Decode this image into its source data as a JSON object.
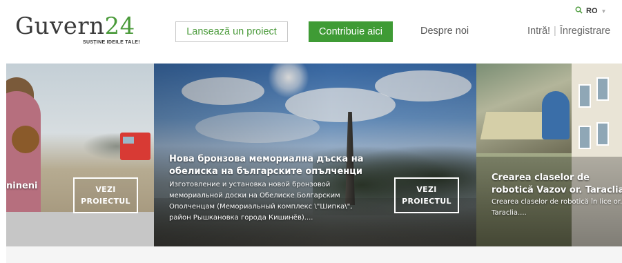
{
  "header": {
    "logo": {
      "word": "Guvern",
      "number": "24",
      "tagline": "SUSȚINE IDEILE TALE!"
    },
    "launch_button": "Lansează un proiect",
    "contribute_button": "Contribuie aici",
    "about_link": "Despre noi",
    "login_link": "Intră!",
    "separator": "|",
    "register_link": "Înregistrare",
    "language": "RO",
    "icons": {
      "search": "search-icon",
      "lang_dropdown": "chevron-down-icon"
    }
  },
  "carousel": {
    "slides": [
      {
        "title": "nineni",
        "button_line1": "VEZI",
        "button_line2": "PROIECTUL"
      },
      {
        "title": "Нова бронзова мемориална дъска на обелиска на българските опълченци",
        "description": "Изготовление и установка новой бронзовой мемориальной доски на Обелиске Болгарским Ополченцам (Мемориальный комплекс \\\"Шипка\\\", район Рышкановка города Кишинёв)....",
        "button_line1": "VEZI",
        "button_line2": "PROIECTUL"
      },
      {
        "title": "Crearea claselor de robotică Vazov or. Taraclia",
        "description": "Crearea claselor de robotică în lice or. Taraclia...."
      }
    ]
  },
  "colors": {
    "brand_green": "#3f9b35",
    "logo_text": "#3a3a3a"
  }
}
